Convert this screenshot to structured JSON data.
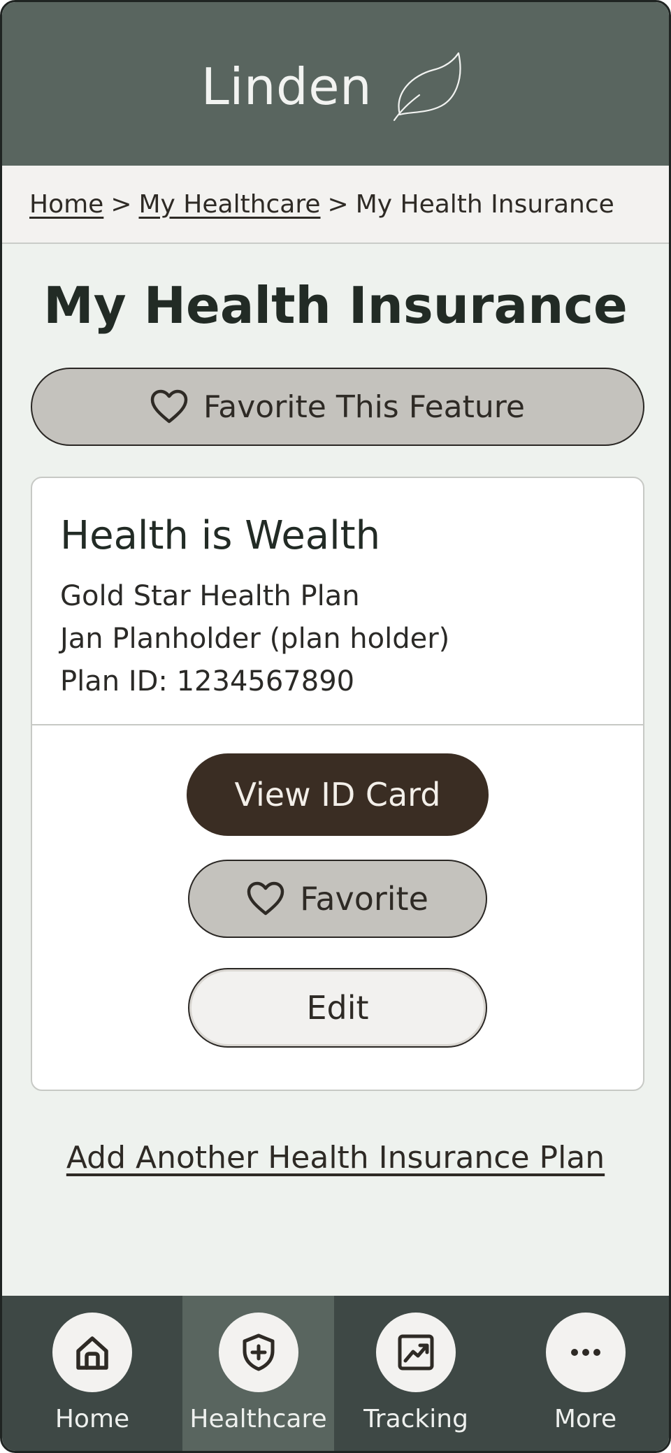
{
  "header": {
    "brand_name": "Linden",
    "logo_icon": "leaf-icon"
  },
  "breadcrumb": {
    "items": [
      {
        "label": "Home",
        "link": true
      },
      {
        "label": "My Healthcare",
        "link": true
      },
      {
        "label": "My Health Insurance",
        "link": false
      }
    ],
    "separator": ">"
  },
  "page": {
    "title": "My Health Insurance",
    "favorite_feature_label": "Favorite This Feature"
  },
  "plan_card": {
    "plan_name": "Health is Wealth",
    "plan_type": "Gold Star Health Plan",
    "holder": "Jan Planholder (plan holder)",
    "plan_id": "Plan ID: 1234567890",
    "view_card_label": "View ID Card",
    "favorite_label": "Favorite",
    "edit_label": "Edit"
  },
  "add_plan_label": "Add Another Health Insurance Plan",
  "bottom_nav": {
    "items": [
      {
        "label": "Home",
        "icon": "home-icon",
        "active": false
      },
      {
        "label": "Healthcare",
        "icon": "shield-plus-icon",
        "active": true
      },
      {
        "label": "Tracking",
        "icon": "chart-icon",
        "active": false
      },
      {
        "label": "More",
        "icon": "more-icon",
        "active": false
      }
    ]
  },
  "colors": {
    "header_bg": "#59655f",
    "page_bg": "#eef2ee",
    "primary_button": "#3a2d23",
    "nav_bg": "#3e4845",
    "nav_active_bg": "#59655f"
  }
}
